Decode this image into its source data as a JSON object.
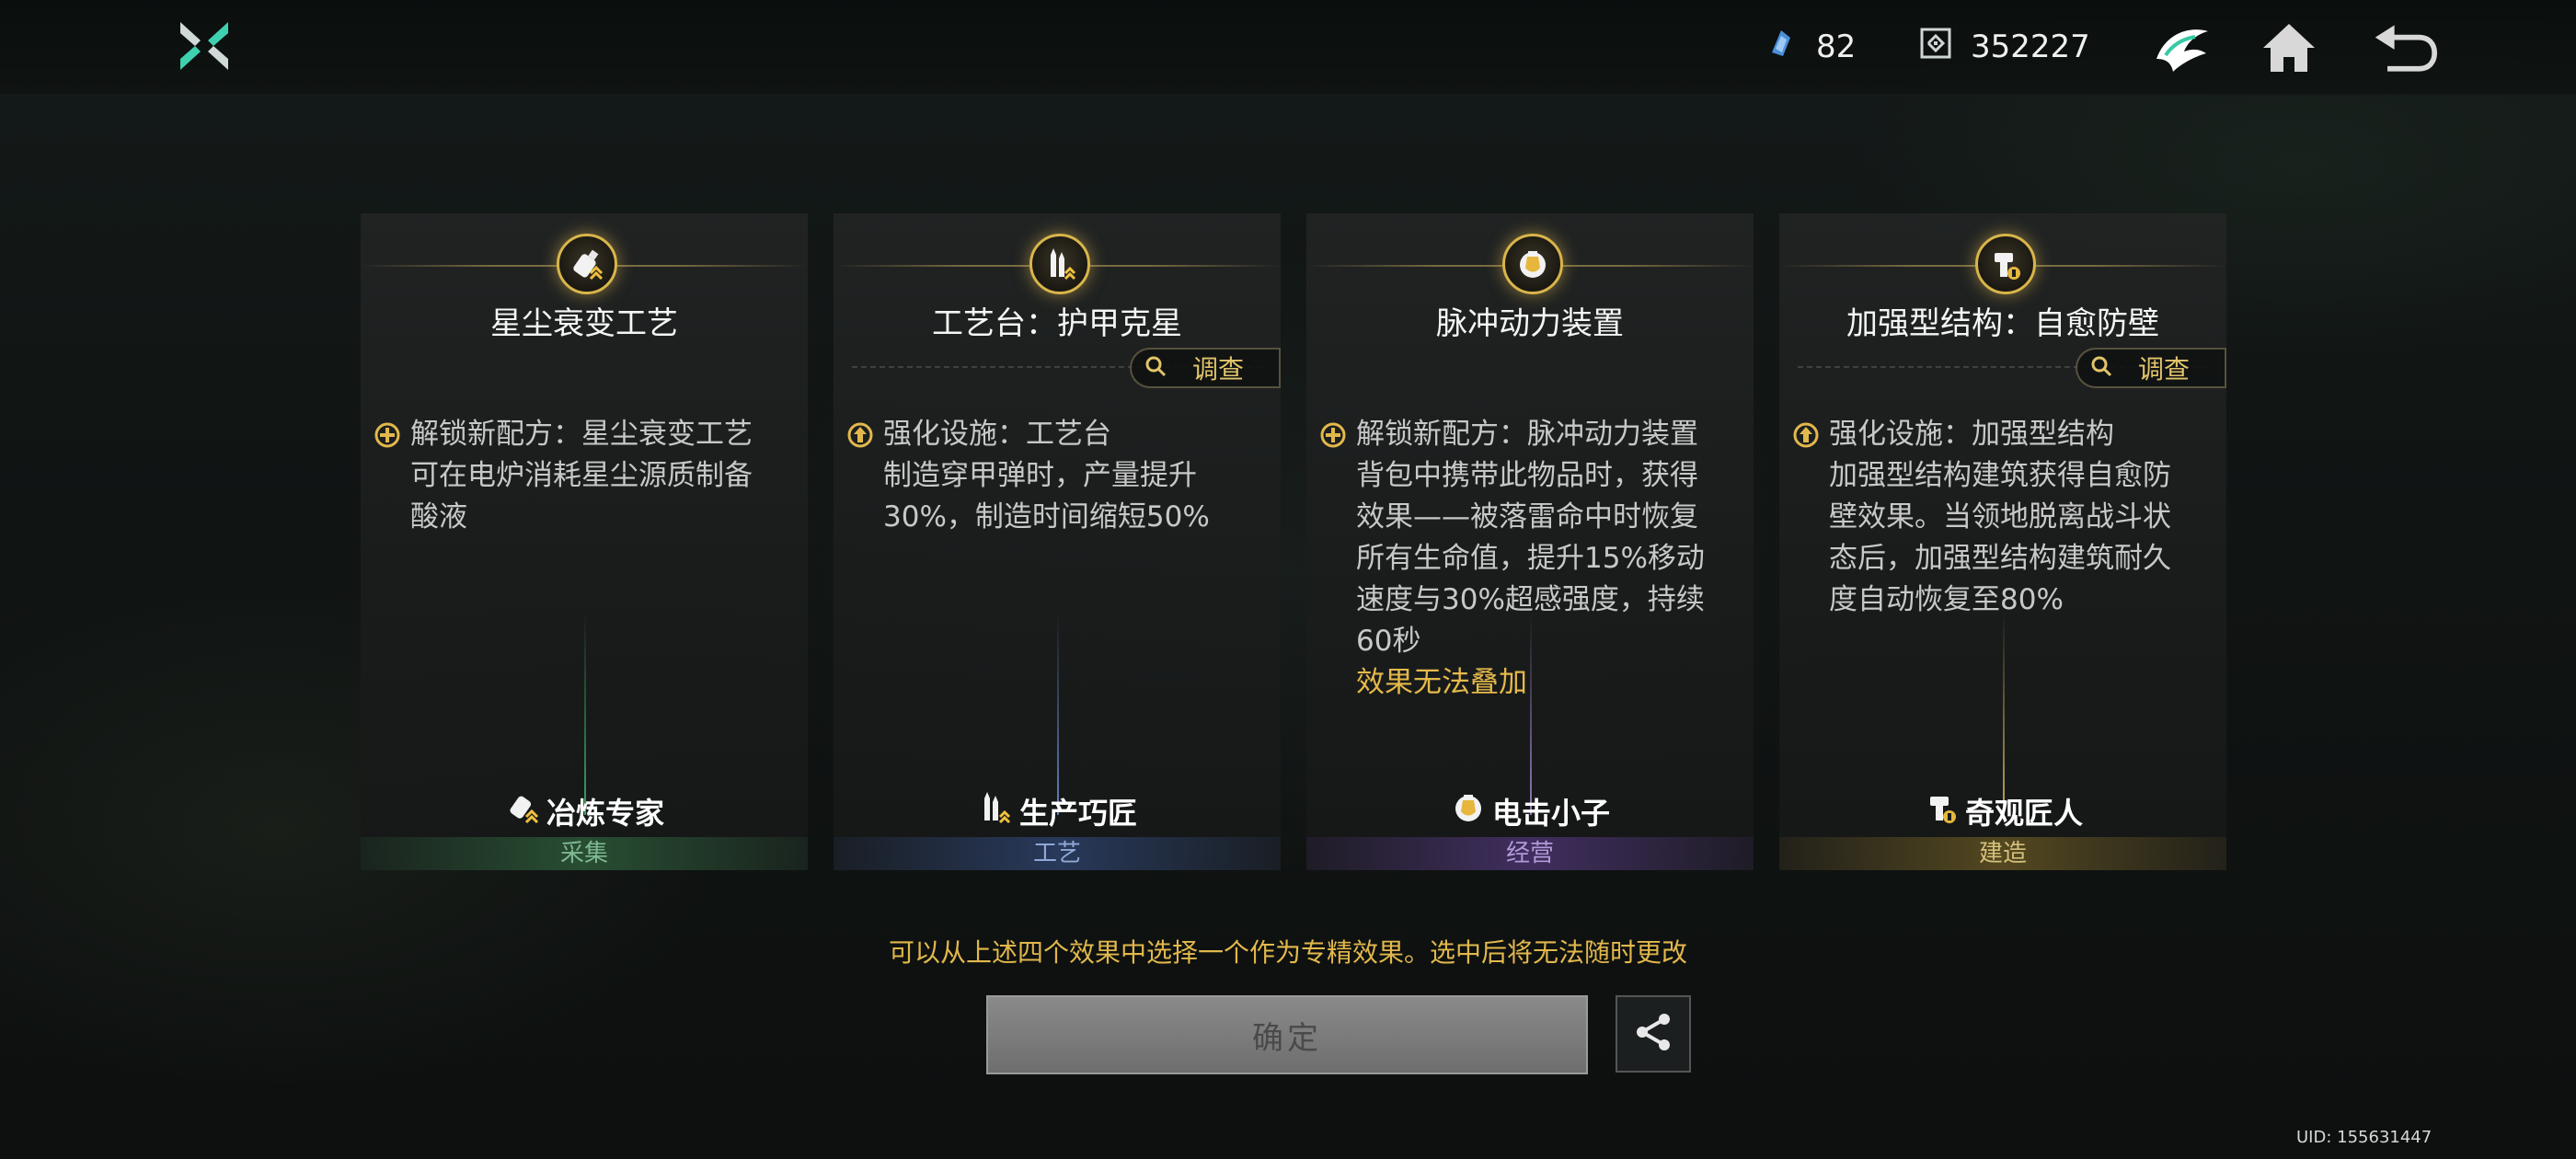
{
  "header": {
    "currency_1": {
      "icon": "crystal-shard-icon",
      "value": "82"
    },
    "currency_2": {
      "icon": "chip-token-icon",
      "value": "352227"
    },
    "icons": [
      "faction-emblem-icon",
      "home-icon",
      "back-arrow-icon"
    ]
  },
  "cards": [
    {
      "title": "星尘衰变工艺",
      "has_search": false,
      "bullet_icon": "unlock-plus-icon",
      "desc": "解锁新配方：星尘衰变工艺\n可在电炉消耗星尘源质制备\n酸液",
      "warning": "",
      "badge_label": "冶炼专家",
      "badge_icon": "bottle-icon",
      "category": "采集",
      "beam_color": "#3fbf6a"
    },
    {
      "title": "工艺台：护甲克星",
      "has_search": true,
      "search_label": "调查",
      "bullet_icon": "upgrade-arrow-icon",
      "desc": "强化设施：工艺台\n制造穿甲弹时，产量提升\n30%，制造时间缩短50%",
      "warning": "",
      "badge_label": "生产巧匠",
      "badge_icon": "ammo-icon",
      "category": "工艺",
      "beam_color": "#6f93d8"
    },
    {
      "title": "脉冲动力装置",
      "has_search": false,
      "bullet_icon": "unlock-plus-icon",
      "desc": "解锁新配方：脉冲动力装置\n背包中携带此物品时，获得\n效果——被落雷命中时恢复\n所有生命值，提升15%移动\n速度与30%超感强度，持续\n60秒",
      "warning": "效果无法叠加",
      "badge_label": "电击小子",
      "badge_icon": "shield-coin-icon",
      "category": "经营",
      "beam_color": "#a98ad8"
    },
    {
      "title": "加强型结构：自愈防壁",
      "has_search": true,
      "search_label": "调查",
      "bullet_icon": "upgrade-arrow-icon",
      "desc": "强化设施：加强型结构\n加强型结构建筑获得自愈防\n壁效果。当领地脱离战斗状\n态后，加强型结构建筑耐久\n度自动恢复至80%",
      "warning": "",
      "badge_label": "奇观匠人",
      "badge_icon": "hammer-icon",
      "category": "建造",
      "beam_color": "#d8c060"
    }
  ],
  "footer": {
    "hint": "可以从上述四个效果中选择一个作为专精效果。选中后将无法随时更改",
    "confirm_label": "确定",
    "uid": "UID: 155631447"
  }
}
